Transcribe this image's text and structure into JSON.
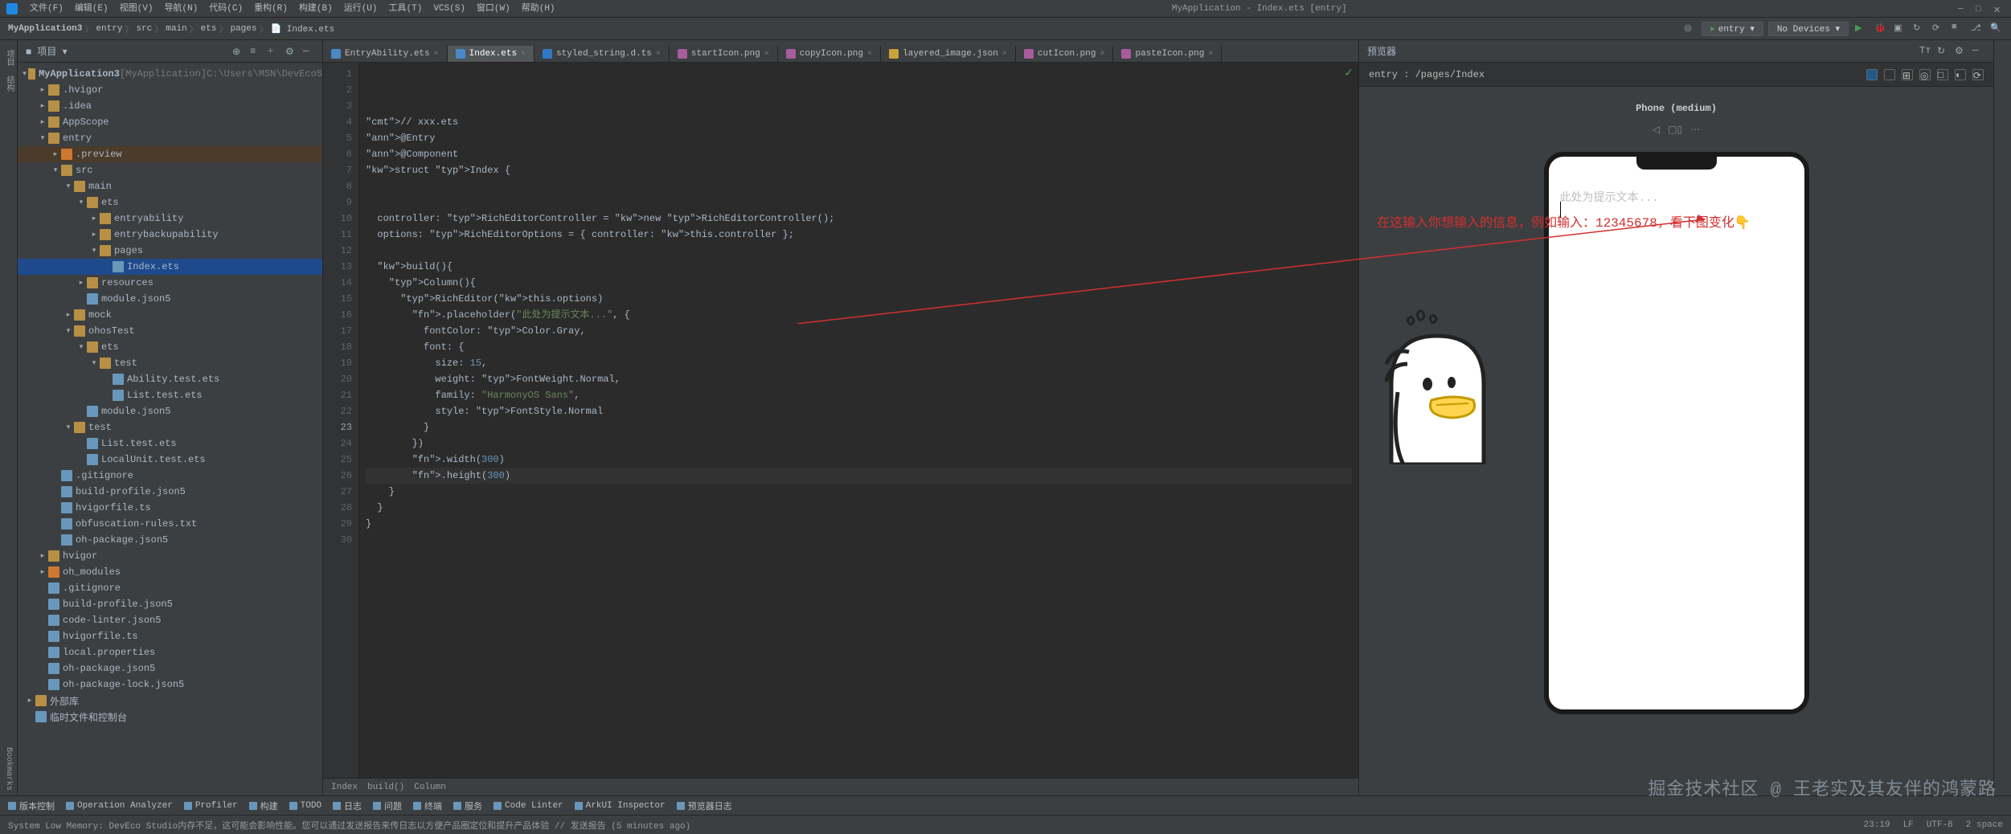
{
  "app_title": "MyApplication - Index.ets [entry]",
  "menu": [
    "文件(F)",
    "编辑(E)",
    "视图(V)",
    "导航(N)",
    "代码(C)",
    "重构(R)",
    "构建(B)",
    "运行(U)",
    "工具(T)",
    "VCS(S)",
    "窗口(W)",
    "帮助(H)"
  ],
  "run_config": "entry",
  "devices": "No Devices ▾",
  "crumbs": [
    "MyApplication3",
    "entry",
    "src",
    "main",
    "ets",
    "pages",
    "Index.ets"
  ],
  "proj_label": "项目",
  "tree": {
    "root": "MyApplication3",
    "root_tag": "[MyApplication]",
    "root_path": "C:\\Users\\MSN\\DevEcoS",
    "items": [
      {
        "d": 1,
        "n": ".hvigor",
        "t": "folder",
        "c": true
      },
      {
        "d": 1,
        "n": ".idea",
        "t": "folder",
        "c": true
      },
      {
        "d": 1,
        "n": "AppScope",
        "t": "folder",
        "c": true
      },
      {
        "d": 1,
        "n": "entry",
        "t": "folder",
        "o": true
      },
      {
        "d": 2,
        "n": ".preview",
        "t": "folder orange",
        "c": true,
        "sel": false,
        "hl": true
      },
      {
        "d": 2,
        "n": "src",
        "t": "folder",
        "o": true
      },
      {
        "d": 3,
        "n": "main",
        "t": "folder",
        "o": true
      },
      {
        "d": 4,
        "n": "ets",
        "t": "folder",
        "o": true
      },
      {
        "d": 5,
        "n": "entryability",
        "t": "folder",
        "c": true
      },
      {
        "d": 5,
        "n": "entrybackupability",
        "t": "folder",
        "c": true
      },
      {
        "d": 5,
        "n": "pages",
        "t": "folder",
        "o": true
      },
      {
        "d": 6,
        "n": "Index.ets",
        "t": "file",
        "sel": true
      },
      {
        "d": 4,
        "n": "resources",
        "t": "folder",
        "c": true
      },
      {
        "d": 4,
        "n": "module.json5",
        "t": "file"
      },
      {
        "d": 3,
        "n": "mock",
        "t": "folder",
        "c": true
      },
      {
        "d": 3,
        "n": "ohosTest",
        "t": "folder",
        "o": true
      },
      {
        "d": 4,
        "n": "ets",
        "t": "folder",
        "o": true
      },
      {
        "d": 5,
        "n": "test",
        "t": "folder",
        "o": true
      },
      {
        "d": 6,
        "n": "Ability.test.ets",
        "t": "file"
      },
      {
        "d": 6,
        "n": "List.test.ets",
        "t": "file"
      },
      {
        "d": 4,
        "n": "module.json5",
        "t": "file"
      },
      {
        "d": 3,
        "n": "test",
        "t": "folder",
        "o": true
      },
      {
        "d": 4,
        "n": "List.test.ets",
        "t": "file"
      },
      {
        "d": 4,
        "n": "LocalUnit.test.ets",
        "t": "file"
      },
      {
        "d": 2,
        "n": ".gitignore",
        "t": "file"
      },
      {
        "d": 2,
        "n": "build-profile.json5",
        "t": "file"
      },
      {
        "d": 2,
        "n": "hvigorfile.ts",
        "t": "file"
      },
      {
        "d": 2,
        "n": "obfuscation-rules.txt",
        "t": "file"
      },
      {
        "d": 2,
        "n": "oh-package.json5",
        "t": "file"
      },
      {
        "d": 1,
        "n": "hvigor",
        "t": "folder",
        "c": true
      },
      {
        "d": 1,
        "n": "oh_modules",
        "t": "folder orange",
        "c": true
      },
      {
        "d": 1,
        "n": ".gitignore",
        "t": "file"
      },
      {
        "d": 1,
        "n": "build-profile.json5",
        "t": "file"
      },
      {
        "d": 1,
        "n": "code-linter.json5",
        "t": "file"
      },
      {
        "d": 1,
        "n": "hvigorfile.ts",
        "t": "file"
      },
      {
        "d": 1,
        "n": "local.properties",
        "t": "file"
      },
      {
        "d": 1,
        "n": "oh-package.json5",
        "t": "file"
      },
      {
        "d": 1,
        "n": "oh-package-lock.json5",
        "t": "file"
      },
      {
        "d": 0,
        "n": "外部库",
        "t": "folder",
        "c": true,
        "ext": true
      },
      {
        "d": 0,
        "n": "临时文件和控制台",
        "t": "file",
        "ext": true
      }
    ]
  },
  "tabs": [
    {
      "n": "EntryAbility.ets",
      "ic": "ets"
    },
    {
      "n": "Index.ets",
      "ic": "ets",
      "active": true
    },
    {
      "n": "styled_string.d.ts",
      "ic": "ts"
    },
    {
      "n": "startIcon.png",
      "ic": "png"
    },
    {
      "n": "copyIcon.png",
      "ic": "png"
    },
    {
      "n": "layered_image.json",
      "ic": "json"
    },
    {
      "n": "cutIcon.png",
      "ic": "png"
    },
    {
      "n": "pasteIcon.png",
      "ic": "png"
    }
  ],
  "code_lines": [
    "// xxx.ets",
    "@Entry",
    "@Component",
    "struct Index {",
    "",
    "",
    "  controller: RichEditorController = new RichEditorController();",
    "  options: RichEditorOptions = { controller: this.controller };",
    "",
    "  build(){",
    "    Column(){",
    "      RichEditor(this.options)",
    "        .placeholder(\"此处为提示文本...\", {",
    "          fontColor: Color.Gray,",
    "          font: {",
    "            size: 15,",
    "            weight: FontWeight.Normal,",
    "            family: \"HarmonyOS Sans\",",
    "            style: FontStyle.Normal",
    "          }",
    "        })",
    "        .width(300)",
    "        .height(300)",
    "    }",
    "  }",
    "}",
    "",
    "",
    "",
    ""
  ],
  "current_line": 23,
  "breadcrumb2": [
    "Index",
    "build()",
    "Column"
  ],
  "previewer_label": "预览器",
  "preview_entry": "entry : /pages/Index",
  "device_label": "Phone (medium)",
  "placeholder_text": "此处为提示文本...",
  "annotation_text": "在这输入你想输入的信息，例如输入：12345678，看下图变化👇",
  "tool_items": [
    "版本控制",
    "Operation Analyzer",
    "Profiler",
    "构建",
    "TODO",
    "日志",
    "问题",
    "终端",
    "服务",
    "Code Linter",
    "ArkUI Inspector",
    "预览器日志"
  ],
  "status_msg": "System Low Memory: DevEco Studio内存不足，这可能会影响性能。您可以通过发送报告来传日志以方便产品圈定位和提升产品体验 // 发送报告 (5 minutes ago)",
  "status_right": {
    "pos": "23:19",
    "enc": "LF",
    "enc2": "UTF-8",
    "indent": "2 space"
  },
  "watermark": "掘金技术社区 @ 王老实及其友伴的鸿蒙路"
}
